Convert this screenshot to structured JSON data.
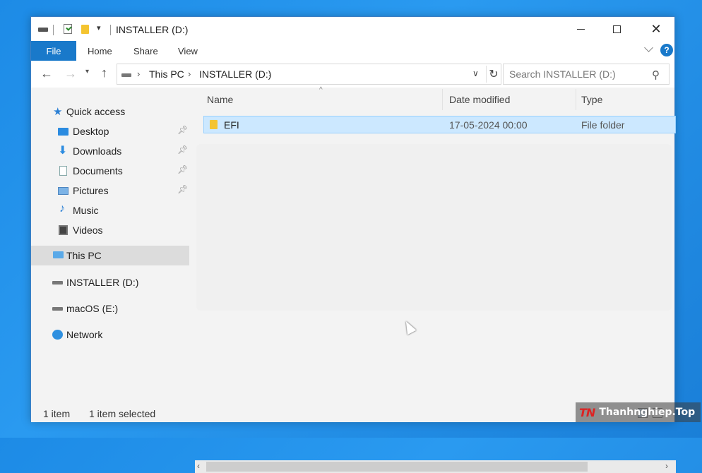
{
  "window": {
    "title": "INSTALLER (D:)",
    "buttons": {
      "minimize": "minimize",
      "maximize": "maximize",
      "close": "✕"
    }
  },
  "ribbon": {
    "tabs": [
      "File",
      "Home",
      "Share",
      "View"
    ],
    "help": "?"
  },
  "address": {
    "crumbs": [
      "This PC",
      "INSTALLER (D:)"
    ],
    "refresh": "↻"
  },
  "search": {
    "placeholder": "Search INSTALLER (D:)"
  },
  "navpane": {
    "quick_access": "Quick access",
    "items": [
      {
        "label": "Desktop",
        "icon": "desktop-icon",
        "pinned": true
      },
      {
        "label": "Downloads",
        "icon": "download-icon",
        "pinned": true
      },
      {
        "label": "Documents",
        "icon": "documents-icon",
        "pinned": true
      },
      {
        "label": "Pictures",
        "icon": "pictures-icon",
        "pinned": true
      },
      {
        "label": "Music",
        "icon": "music-icon",
        "pinned": false
      },
      {
        "label": "Videos",
        "icon": "videos-icon",
        "pinned": false
      }
    ],
    "this_pc": "This PC",
    "installer": "INSTALLER (D:)",
    "macos": "macOS (E:)",
    "network": "Network"
  },
  "filelist": {
    "columns": [
      "Name",
      "Date modified",
      "Type"
    ],
    "rows": [
      {
        "name": "EFI",
        "date": "17-05-2024 00:00",
        "type": "File folder",
        "selected": true
      }
    ]
  },
  "status": {
    "count": "1 item",
    "selected": "1 item selected"
  },
  "watermark": {
    "logo": "TN",
    "text": "Thanhnghiep.Top"
  },
  "colors": {
    "accent": "#1979ca",
    "selection": "#cce8ff",
    "desktop": "#1d8be6"
  }
}
